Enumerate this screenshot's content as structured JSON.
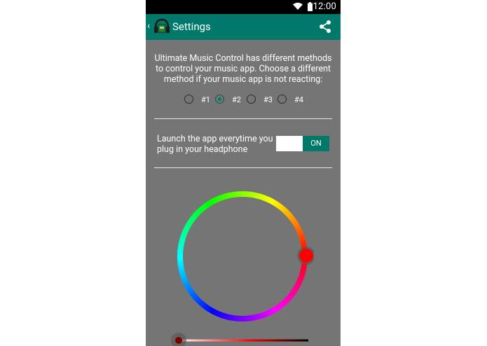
{
  "status_bar": {
    "time": "12:00"
  },
  "app_bar": {
    "title": "Settings"
  },
  "settings": {
    "description": "Ultimate Music Control has different methods to control your music app. Choose a different method if your music app is not reacting:",
    "methods": [
      {
        "label": "#1",
        "selected": false
      },
      {
        "label": "#2",
        "selected": true
      },
      {
        "label": "#3",
        "selected": false
      },
      {
        "label": "#4",
        "selected": false
      }
    ],
    "launch_label": "Launch the app everytime you plug in your headphone",
    "toggle_label": "ON",
    "toggle_on": true
  },
  "colors": {
    "accent": "#00796b",
    "background": "#757575",
    "selected_color": "#ff0000"
  },
  "icons": [
    "back-chevron-icon",
    "headphone-app-icon",
    "share-icon",
    "wifi-icon",
    "battery-icon"
  ]
}
